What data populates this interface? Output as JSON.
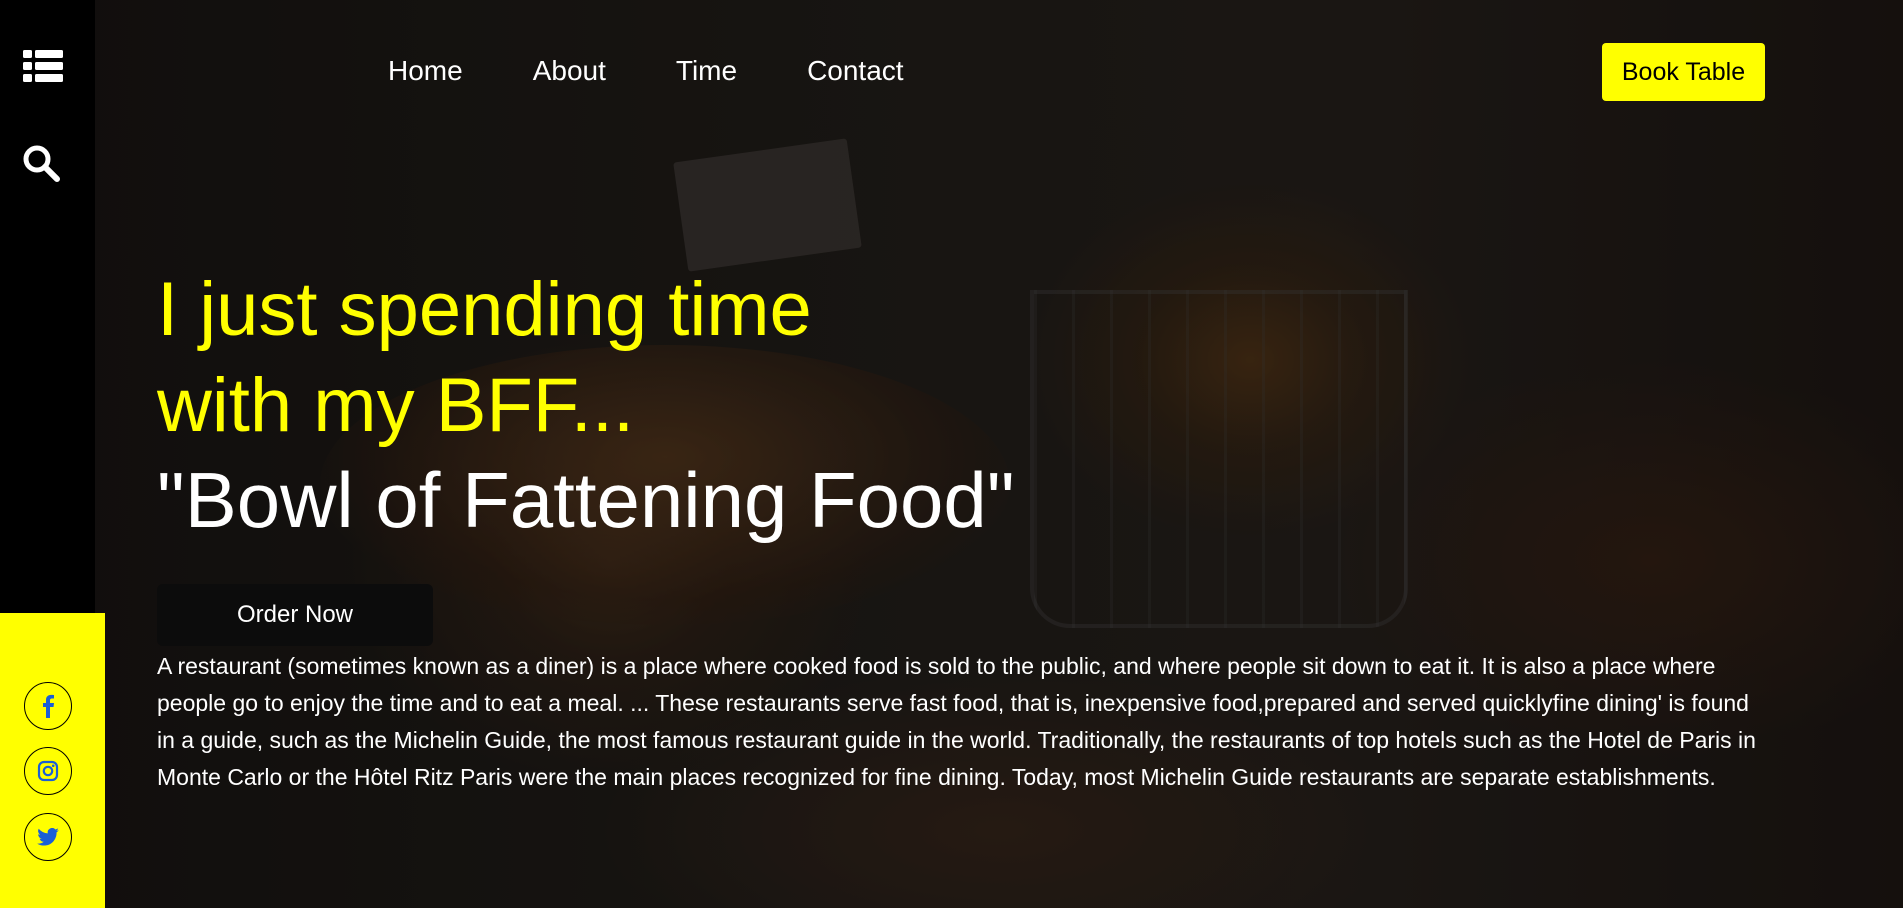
{
  "sidebar": {
    "menu_icon": "list-menu-icon",
    "search_icon": "search-icon"
  },
  "nav": {
    "items": [
      "Home",
      "About",
      "Time",
      "Contact"
    ]
  },
  "header": {
    "book_label": "Book Table"
  },
  "hero": {
    "line1": "I just spending time",
    "line2": "with my BFF...",
    "line3": "\"Bowl of Fattening Food\"",
    "order_label": "Order Now",
    "description": "A restaurant (sometimes known as a diner) is a place where cooked food is sold to the public, and where people sit down to eat it. It is also a place where people go to enjoy the time and to eat a meal. ... These restaurants serve fast food, that is, inexpensive food,prepared and served quicklyfine dining' is found in a guide, such as the Michelin Guide, the most famous restaurant guide in the world. Traditionally, the restaurants of top hotels such as the Hotel de Paris in Monte Carlo or the Hôtel Ritz Paris were the main places recognized for fine dining. Today, most Michelin Guide restaurants are separate establishments."
  },
  "social": {
    "icons": [
      "facebook-icon",
      "instagram-icon",
      "twitter-icon"
    ]
  },
  "colors": {
    "accent": "#ffff00",
    "sidebar": "#000000",
    "text": "#ffffff"
  }
}
